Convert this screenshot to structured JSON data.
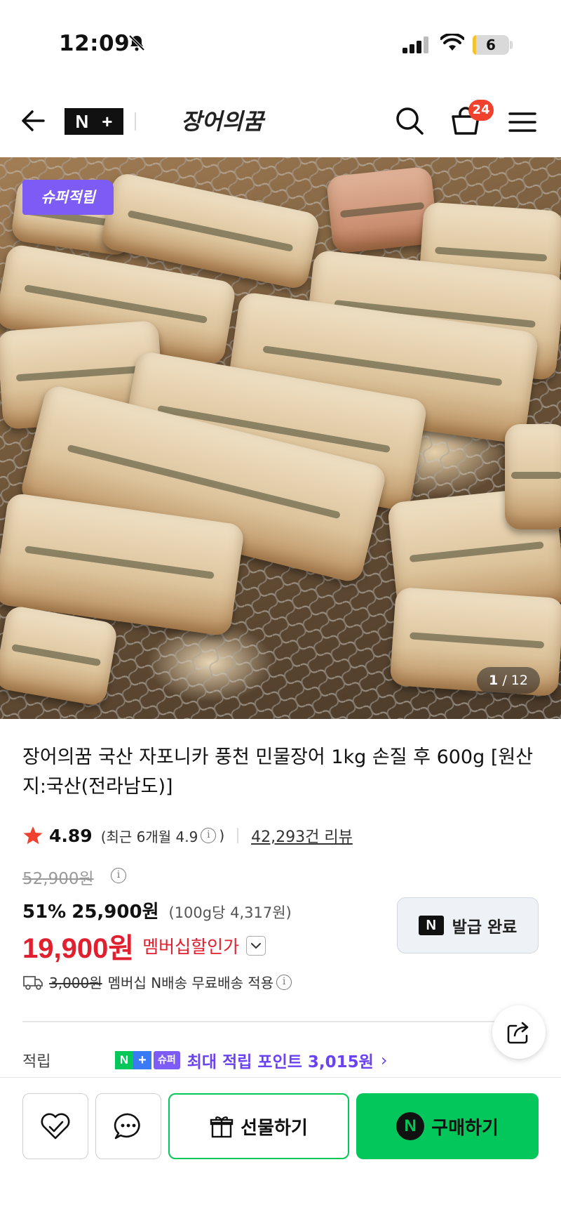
{
  "status_bar": {
    "time": "12:09",
    "battery": "6",
    "icons": [
      "bell-off-icon",
      "signal-icon",
      "wifi-icon",
      "battery-icon"
    ]
  },
  "nav": {
    "logo_n": "N",
    "logo_plus": "+",
    "store_name": "장어의꿈",
    "cart_count": "24",
    "icons": [
      "back-arrow-icon",
      "search-icon",
      "cart-icon",
      "hamburger-menu-icon"
    ]
  },
  "gallery": {
    "promo_badge": "슈퍼적립",
    "current": "1",
    "separator": " / ",
    "total": "12"
  },
  "product": {
    "title": "장어의꿈 국산 자포니카 풍천 민물장어 1kg 손질 후 600g [원산지:국산(전라남도)]",
    "rating": "4.89",
    "rating_recent_prefix": "(최근 6개월 4.9",
    "rating_recent_suffix": ")",
    "review_count": "42,293건 리뷰",
    "original_price": "52,900원",
    "discount": "51%",
    "sale_price": "25,900원",
    "unit_price": "(100g당 4,317원)",
    "member_price": "19,900원",
    "member_label": "멤버십할인가",
    "coupon_n": "N",
    "coupon_label": "발급 완료",
    "shipping_old": "3,000원",
    "shipping_text": "멤버십 N배송 무료배송 적용",
    "points_label": "적립",
    "points_badge_n": "N",
    "points_badge_plus": "+",
    "points_badge_super": "슈퍼",
    "points_text": "최대 적립 포인트 3,015원",
    "points_chevron": "›"
  },
  "actions": {
    "gift_label": "선물하기",
    "buy_n": "N",
    "buy_label": "구매하기"
  },
  "colors": {
    "naver_green": "#03c75a",
    "member_red": "#e0202f",
    "super_purple": "#7c5cf5",
    "badge_red": "#f0402e"
  }
}
